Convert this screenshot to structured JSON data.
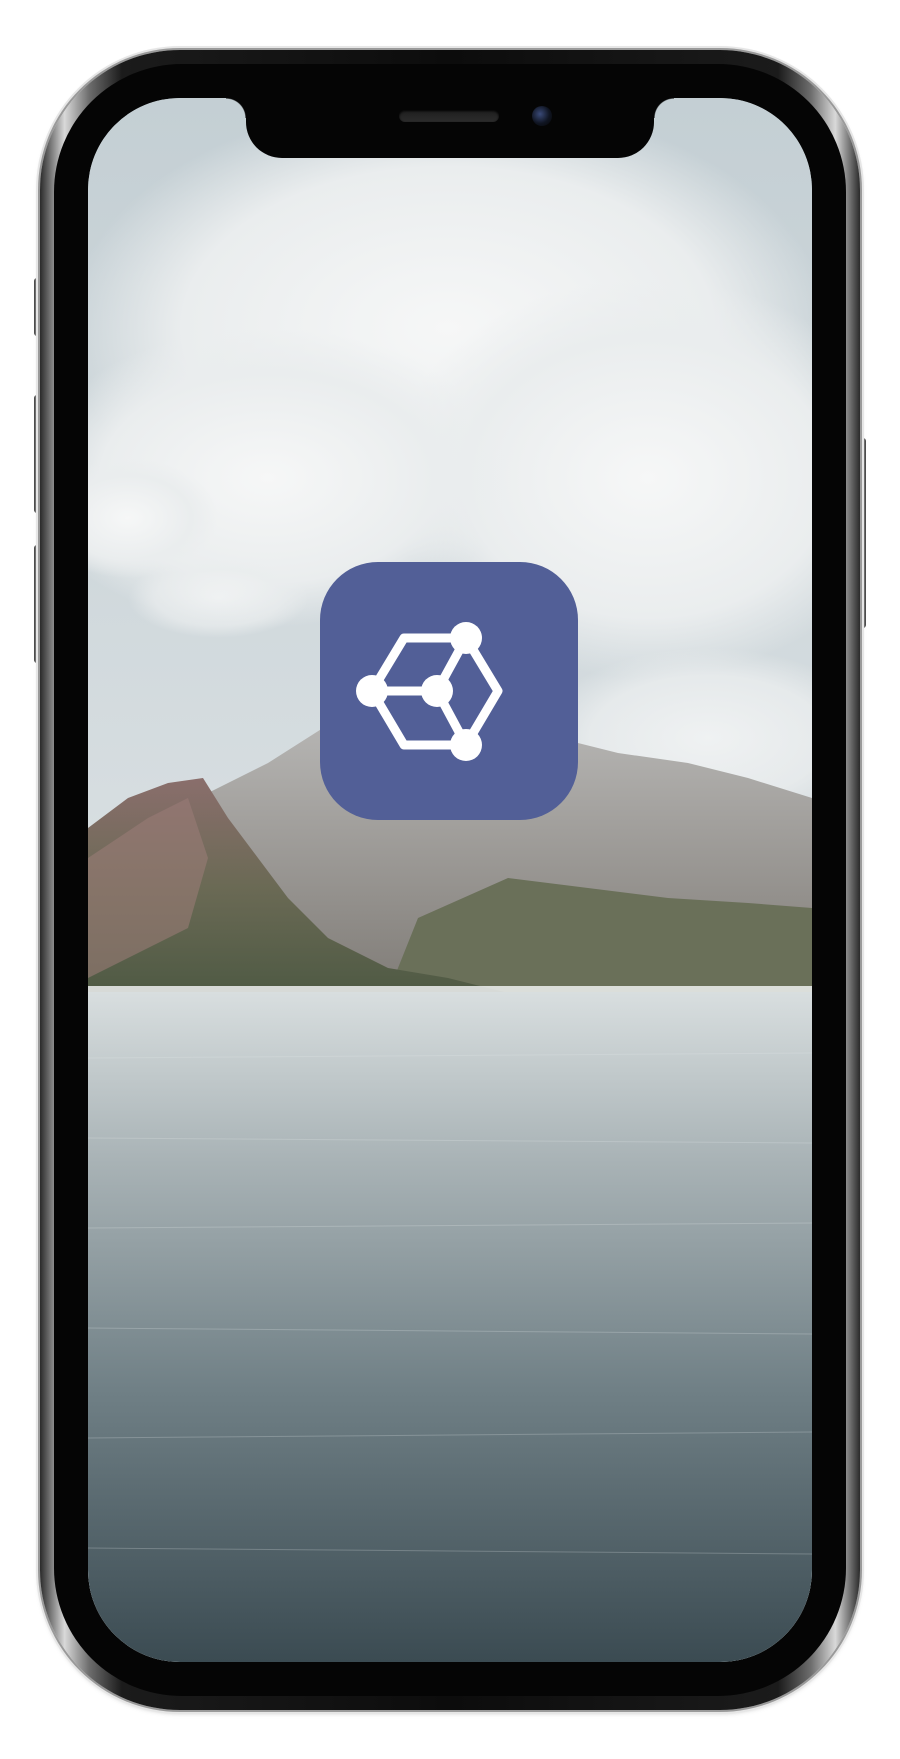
{
  "device": {
    "model": "phone",
    "frame_color": "#0c0c0c",
    "bezel_color": "#050505"
  },
  "screen": {
    "wallpaper": "coastal-mountain-landscape",
    "wallpaper_colors": {
      "sky": "#c9d3d7",
      "cloud": "#eef0f0",
      "mountain": "#6f6a66",
      "water": "#4d5d64"
    }
  },
  "app_icon": {
    "icon": "cube-network-icon",
    "background_color": "#525f97",
    "glyph_color": "#ffffff"
  }
}
